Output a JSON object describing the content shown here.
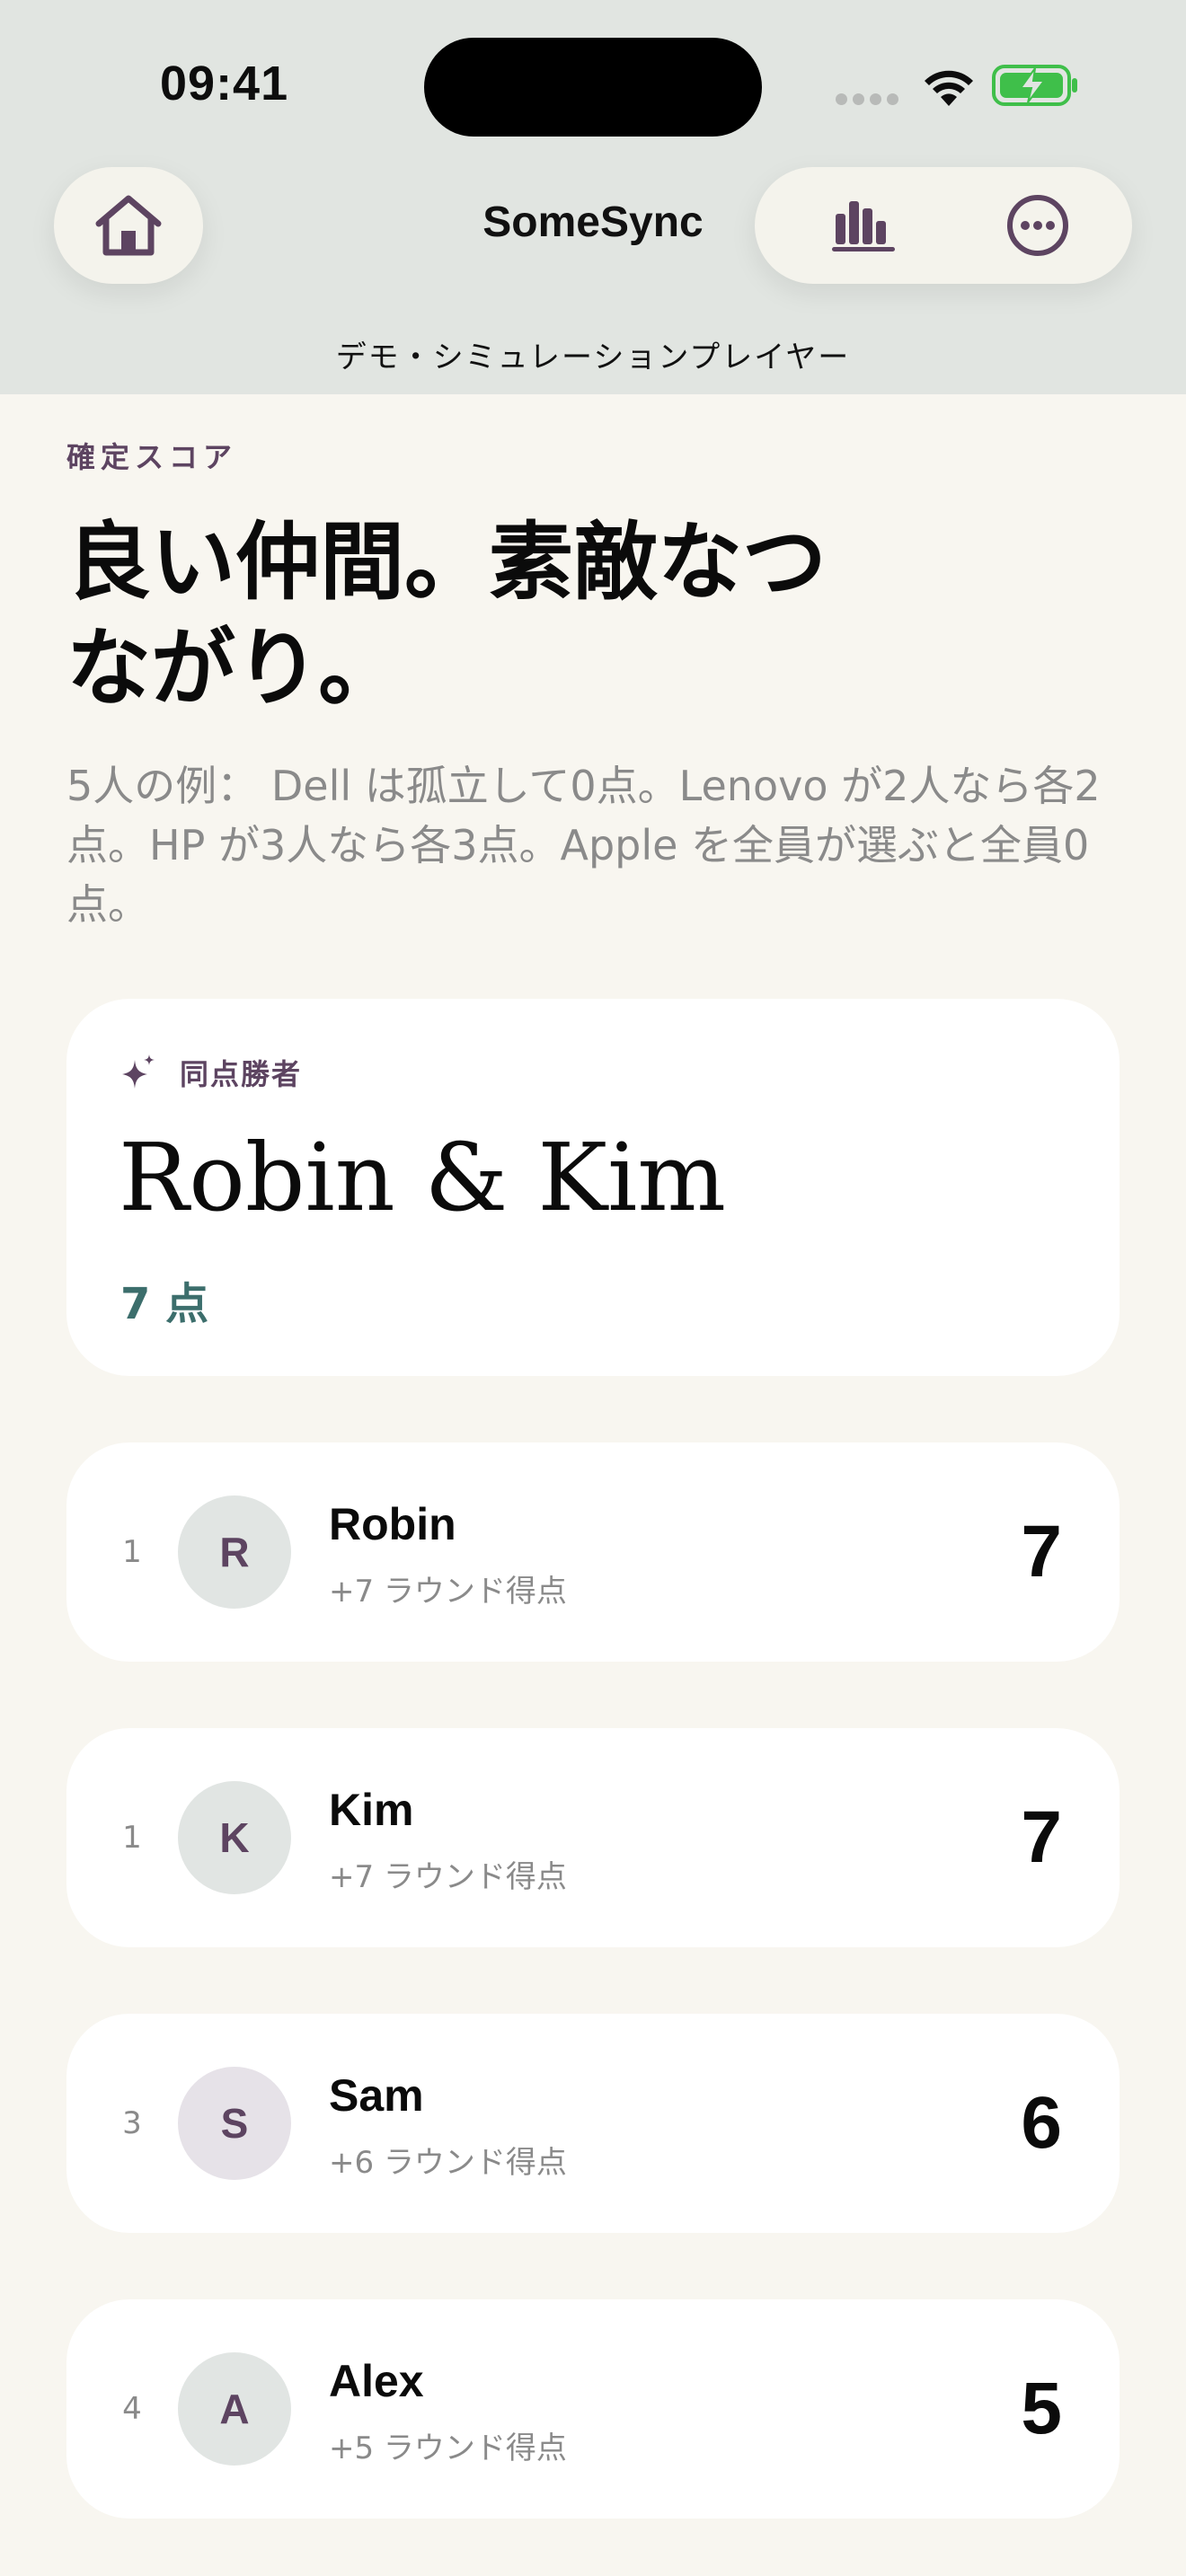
{
  "status_bar": {
    "time": "09:41"
  },
  "header": {
    "title": "SomeSync",
    "subtitle": "デモ・シミュレーションプレイヤー",
    "icons": {
      "home": "home-icon",
      "stats": "bar-chart-icon",
      "more": "more-ellipsis-icon"
    }
  },
  "intro": {
    "eyebrow": "確定スコア",
    "headline": "良い仲間。素敵なつながり。",
    "description": "5人の例： Dell は孤立して0点。Lenovo が2人なら各2点。HP が3人なら各3点。Apple を全員が選ぶと全員0点。"
  },
  "winner": {
    "label": "同点勝者",
    "names": "Robin & Kim",
    "points": "7 点",
    "icon": "sparkle-icon"
  },
  "standings": [
    {
      "rank": "1",
      "initial": "R",
      "name": "Robin",
      "round": "+7 ラウンド得点",
      "score": "7"
    },
    {
      "rank": "1",
      "initial": "K",
      "name": "Kim",
      "round": "+7 ラウンド得点",
      "score": "7"
    },
    {
      "rank": "3",
      "initial": "S",
      "name": "Sam",
      "round": "+6 ラウンド得点",
      "score": "6"
    },
    {
      "rank": "4",
      "initial": "A",
      "name": "Alex",
      "round": "+5 ラウンド得点",
      "score": "5"
    }
  ],
  "colors": {
    "accent_purple": "#5d4461",
    "points_teal": "#3c6e6c",
    "header_bg": "#e1e5e1",
    "page_bg": "#f8f6f0",
    "battery_green": "#3fbf4a"
  }
}
